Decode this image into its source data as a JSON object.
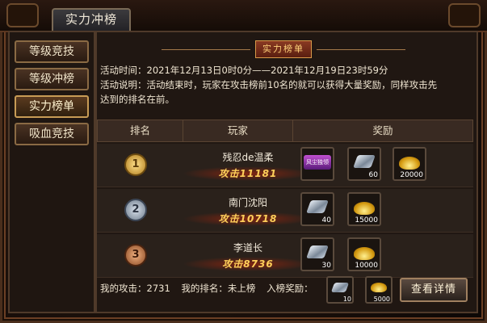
{
  "window": {
    "title": "实力冲榜"
  },
  "sidebar": {
    "items": [
      {
        "label": "等级竞技",
        "active": false
      },
      {
        "label": "等级冲榜",
        "active": false
      },
      {
        "label": "实力榜单",
        "active": true
      },
      {
        "label": "吸血竞技",
        "active": false
      }
    ]
  },
  "panel": {
    "title": "实力榜单",
    "time_label": "活动时间：2021年12月13日0时0分——2021年12月19日23时59分",
    "desc_line1": "活动说明：活动结束时，玩家在攻击榜前10名的就可以获得大量奖励，同样攻击先",
    "desc_line2": "达到的排名在前。"
  },
  "table": {
    "headers": [
      "排名",
      "玩家",
      "奖励"
    ],
    "rows": [
      {
        "rank": "1",
        "player": "残忍de温柔",
        "power": "攻击11181",
        "rewards": [
          {
            "icon": "title-badge-icon",
            "text": "风尘独领",
            "qty": ""
          },
          {
            "icon": "upgrade-chip-icon",
            "qty": "60"
          },
          {
            "icon": "gold-ingot-icon",
            "qty": "20000"
          }
        ]
      },
      {
        "rank": "2",
        "player": "南门沈阳",
        "power": "攻击10718",
        "rewards": [
          {
            "icon": "upgrade-chip-icon",
            "qty": "40"
          },
          {
            "icon": "gold-ingot-icon",
            "qty": "15000"
          }
        ]
      },
      {
        "rank": "3",
        "player": "李道长",
        "power": "攻击8736",
        "rewards": [
          {
            "icon": "upgrade-chip-icon",
            "qty": "30"
          },
          {
            "icon": "gold-ingot-icon",
            "qty": "10000"
          }
        ]
      }
    ]
  },
  "footer": {
    "my_attack": "我的攻击：2731",
    "my_rank": "我的排名：未上榜",
    "reward_label": "入榜奖励：",
    "reward_items": [
      {
        "icon": "upgrade-chip-icon",
        "qty": "10"
      },
      {
        "icon": "gold-ingot-icon",
        "qty": "5000"
      }
    ],
    "detail_button": "查看详情"
  }
}
